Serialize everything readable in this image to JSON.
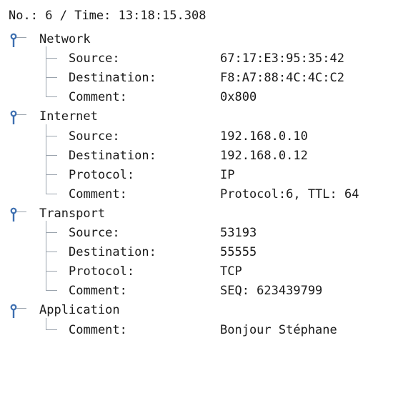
{
  "header": {
    "number_label": "No.:",
    "number_value": "6",
    "separator": "/",
    "time_label": "Time:",
    "time_value": "13:18:15.308"
  },
  "sections": [
    {
      "name": "Network",
      "fields": [
        {
          "label": "Source:",
          "value": "67:17:E3:95:35:42"
        },
        {
          "label": "Destination:",
          "value": "F8:A7:88:4C:4C:C2"
        },
        {
          "label": "Comment:",
          "value": "0x800"
        }
      ]
    },
    {
      "name": "Internet",
      "fields": [
        {
          "label": "Source:",
          "value": "192.168.0.10"
        },
        {
          "label": "Destination:",
          "value": "192.168.0.12"
        },
        {
          "label": "Protocol:",
          "value": "IP"
        },
        {
          "label": "Comment:",
          "value": "Protocol:6, TTL: 64"
        }
      ]
    },
    {
      "name": "Transport",
      "fields": [
        {
          "label": "Source:",
          "value": "53193"
        },
        {
          "label": "Destination:",
          "value": "55555"
        },
        {
          "label": "Protocol:",
          "value": "TCP"
        },
        {
          "label": "Comment:",
          "value": "SEQ: 623439799"
        }
      ]
    },
    {
      "name": "Application",
      "fields": [
        {
          "label": "Comment:",
          "value": "Bonjour Stéphane"
        }
      ]
    }
  ],
  "icons": {
    "toggle": "expanded-node-icon"
  },
  "colors": {
    "tree_line": "#9aa3ad",
    "toggle_icon": "#3d6fb0",
    "text": "#1a1a1a"
  }
}
